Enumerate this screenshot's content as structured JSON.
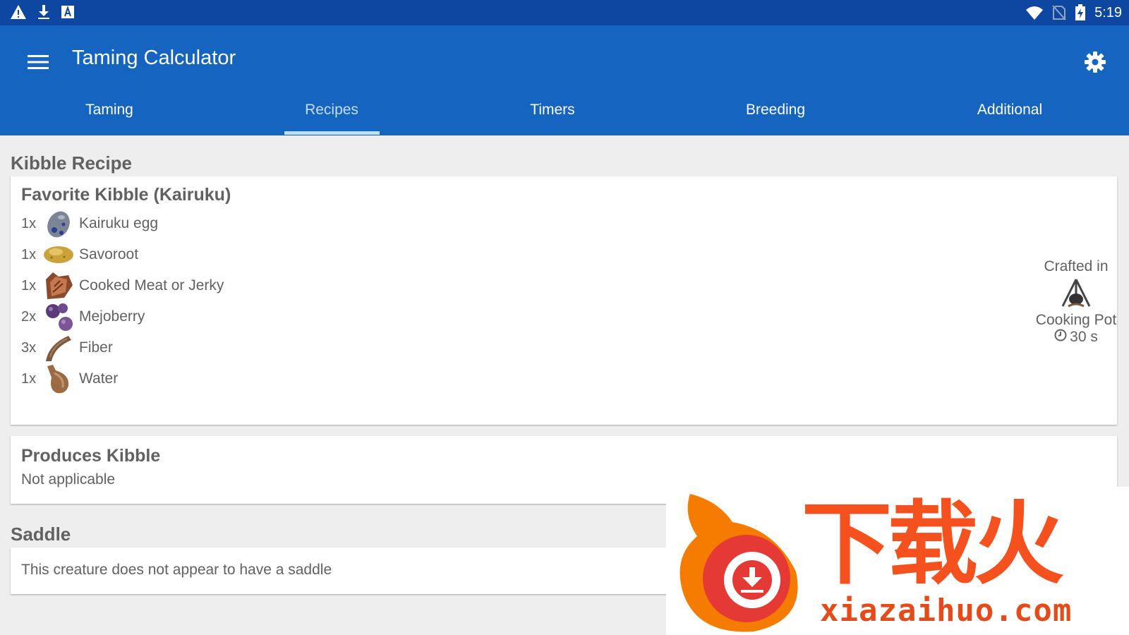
{
  "status_bar": {
    "time": "5:19",
    "left_icons": [
      "warning-icon",
      "download-icon",
      "font-icon"
    ],
    "right_icons": [
      "wifi-icon",
      "no-sim-icon",
      "battery-charging-icon"
    ]
  },
  "app_bar": {
    "title": "Taming Calculator",
    "menu_icon": "hamburger-menu-icon",
    "settings_icon": "gear-icon",
    "color": "#1565c0"
  },
  "tabs": [
    {
      "label": "Taming",
      "active": false
    },
    {
      "label": "Recipes",
      "active": true
    },
    {
      "label": "Timers",
      "active": false
    },
    {
      "label": "Breeding",
      "active": false
    },
    {
      "label": "Additional",
      "active": false
    }
  ],
  "kibble_recipe": {
    "section_title": "Kibble Recipe",
    "card_title": "Favorite Kibble (Kairuku)",
    "ingredients": [
      {
        "qty": "1x",
        "name": "Kairuku egg",
        "icon": "egg-icon"
      },
      {
        "qty": "1x",
        "name": "Savoroot",
        "icon": "savoroot-icon"
      },
      {
        "qty": "1x",
        "name": "Cooked Meat or Jerky",
        "icon": "meat-icon"
      },
      {
        "qty": "2x",
        "name": "Mejoberry",
        "icon": "berry-icon"
      },
      {
        "qty": "3x",
        "name": "Fiber",
        "icon": "fiber-icon"
      },
      {
        "qty": "1x",
        "name": "Water",
        "icon": "waterskin-icon"
      }
    ],
    "crafted": {
      "label": "Crafted in",
      "station": "Cooking Pot",
      "station_icon": "cooking-pot-icon",
      "time": "30 s",
      "time_icon": "clock-icon"
    }
  },
  "produces": {
    "title": "Produces Kibble",
    "value": "Not applicable"
  },
  "saddle": {
    "section_title": "Saddle",
    "text": "This creature does not appear to have a saddle"
  },
  "watermark": {
    "chinese": "下载火",
    "url": "xiazaihuo.com"
  }
}
